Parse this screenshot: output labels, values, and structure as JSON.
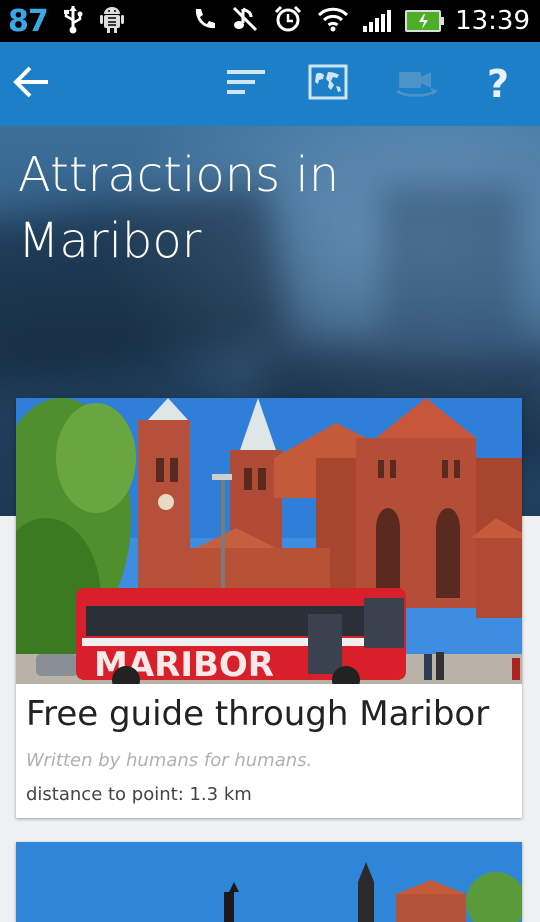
{
  "status_bar": {
    "battery_percent_text": "87",
    "time": "13:39",
    "icons": [
      "usb-icon",
      "android-debug-icon",
      "phone-icon",
      "mute-icon",
      "alarm-icon",
      "wifi-icon",
      "signal-icon",
      "battery-charging-icon"
    ]
  },
  "action_bar": {
    "color": "#1c7fc7",
    "icons": [
      "back-arrow-icon",
      "sort-icon",
      "map-icon",
      "video-camera-icon",
      "help-icon"
    ],
    "help_label": "?"
  },
  "page": {
    "title": "Attractions in Maribor"
  },
  "cards": [
    {
      "image": "cathedral-with-red-bus-photo",
      "title": "Free guide through Maribor",
      "tagline": "Written by humans for humans.",
      "distance_text": "distance to point: 1.3 km",
      "bus_text": "MARIBOR"
    },
    {
      "image": "blue-sky-town-photo"
    }
  ]
}
